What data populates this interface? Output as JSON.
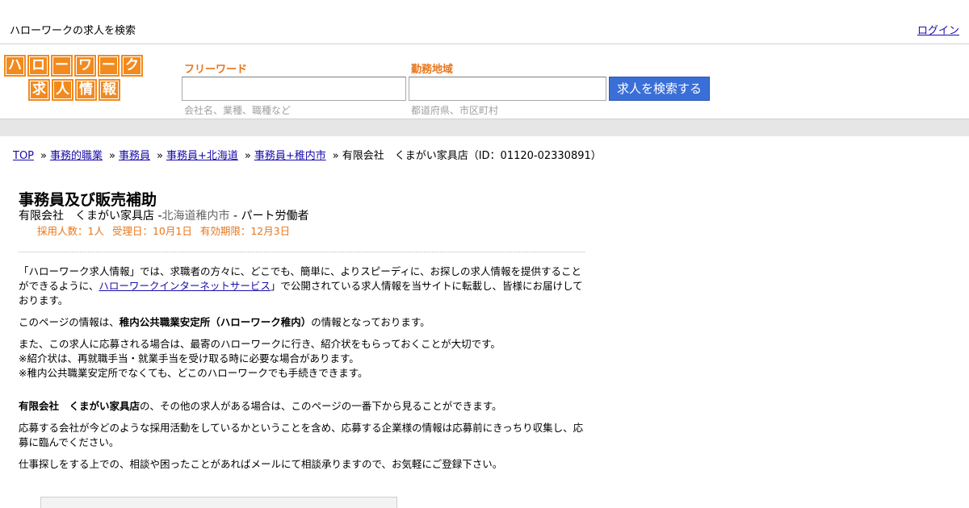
{
  "topbar": {
    "tagline": "ハローワークの求人を検索",
    "login": "ログイン"
  },
  "logo": {
    "row1": [
      "ハ",
      "ロ",
      "ー",
      "ワ",
      "ー",
      "ク"
    ],
    "row2": [
      "求",
      "人",
      "情",
      "報"
    ]
  },
  "search": {
    "freeword_label": "フリーワード",
    "freeword_value": "",
    "freeword_hint": "会社名、業種、職種など",
    "area_label": "勤務地域",
    "area_value": "",
    "area_hint": "都道府県、市区町村",
    "button": "求人を検索する"
  },
  "breadcrumb": {
    "items": [
      "TOP",
      "事務的職業",
      "事務員",
      "事務員+北海道",
      "事務員+稚内市"
    ],
    "current": "有限会社　くまがい家具店（ID：01120-02330891）"
  },
  "job": {
    "title": "事務員及び販売補助",
    "company": "有限会社　くまがい家具店",
    "location": "北海道稚内市",
    "employment": "パート労働者",
    "hires": "採用人数：1人",
    "received": "受理日：10月1日",
    "expires": "有効期限：12月3日"
  },
  "content": {
    "p1_a": "「ハローワーク求人情報」では、求職者の方々に、どこでも、簡単に、よりスピーディに、お探しの求人情報を提供することができるように、",
    "p1_link": "ハローワークインターネットサービス",
    "p1_b": "」で公開されている求人情報を当サイトに転載し、皆様にお届けしております。",
    "p2_a": "このページの情報は、",
    "p2_b": "稚内公共職業安定所（ハローワーク稚内）",
    "p2_c": "の情報となっております。",
    "p3_1": "また、この求人に応募される場合は、最寄のハローワークに行き、紹介状をもらっておくことが大切です。",
    "p3_2": "※紹介状は、再就職手当・就業手当を受け取る時に必要な場合があります。",
    "p3_3": "※稚内公共職業安定所でなくても、どこのハローワークでも手続きできます。",
    "p4_a": "有限会社　くまがい家具店",
    "p4_b": "の、その他の求人がある場合は、このページの一番下から見ることができます。",
    "p5": "応募する会社が今どのような採用活動をしているかということを含め、応募する企業様の情報は応募前にきっちり収集し、応募に臨んでください。",
    "p6": "仕事探しをする上での、相談や困ったことがあればメールにて相談承りますので、お気軽にご登録下さい。"
  }
}
